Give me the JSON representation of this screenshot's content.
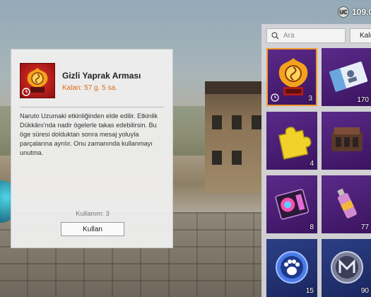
{
  "currency": {
    "amount": "109.0",
    "icon": "uc-coin-icon"
  },
  "item_panel": {
    "title": "Gizli Yaprak Arması",
    "remaining": "Kalan: 57 g. 5 sa.",
    "description": "Naruto Uzumaki etkinliğinden elde edilir. Etkinlik Dükkânı'nda nadir ögelerle takas edebilirsin. Bu öge süresi dolduktan sonra mesaj yoluyla parçalarına ayrılır. Onu zamanında kullanmayı unutma.",
    "usage": "Kullanım: 3",
    "use_button": "Kullan",
    "accent_color": "#e06a10"
  },
  "inventory": {
    "search_placeholder": "Ara",
    "filter_label": "Kalı",
    "items": [
      {
        "name": "Gizli Yaprak Arması",
        "count": "3",
        "icon": "hidden-leaf-emblem-icon",
        "selected": true
      },
      {
        "name": "card-voucher",
        "count": "170",
        "icon": "ticket-card-icon",
        "selected": false
      },
      {
        "name": "puzzle-piece",
        "count": "4",
        "icon": "puzzle-piece-icon",
        "selected": false
      },
      {
        "name": "engine-part",
        "count": "",
        "icon": "engine-icon",
        "selected": false
      },
      {
        "name": "color-card",
        "count": "8",
        "icon": "color-palette-card-icon",
        "selected": false
      },
      {
        "name": "spray-paint",
        "count": "77",
        "icon": "spray-can-icon",
        "selected": false
      },
      {
        "name": "pet-token",
        "count": "15",
        "icon": "paw-token-icon",
        "selected": false
      },
      {
        "name": "mythic-token",
        "count": "90",
        "icon": "m-token-icon",
        "selected": false
      }
    ]
  }
}
